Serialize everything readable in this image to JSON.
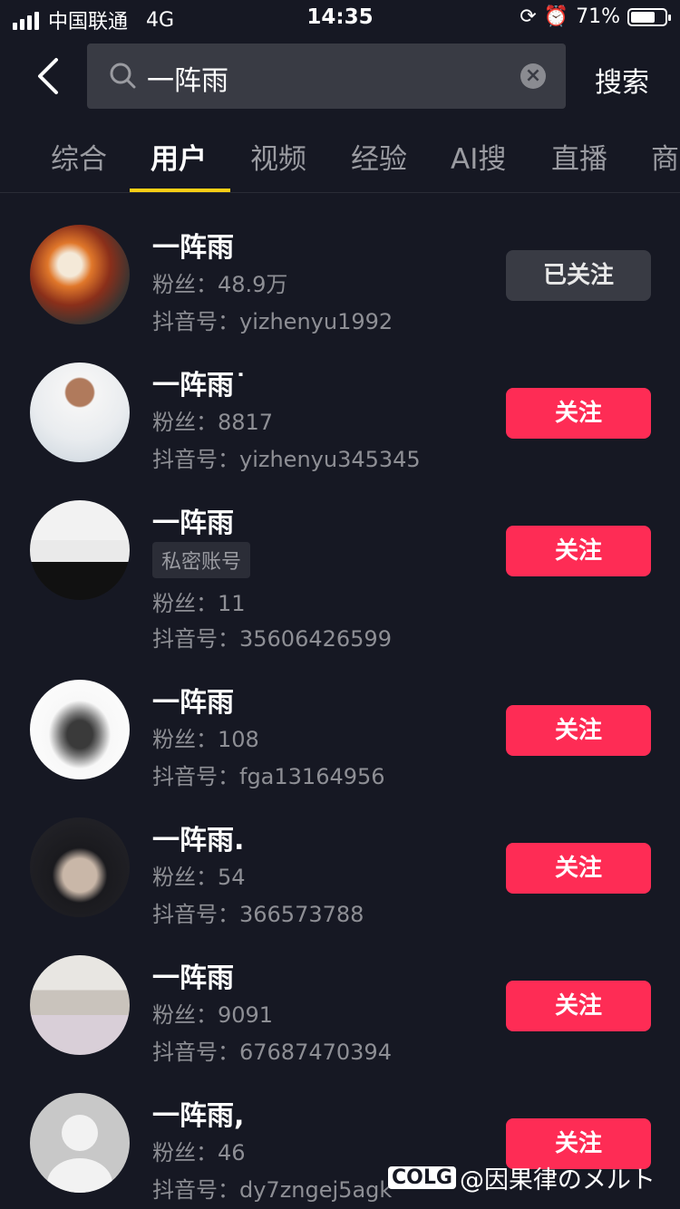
{
  "status_bar": {
    "carrier": "中国联通",
    "network": "4G",
    "time": "14:35",
    "battery": "71%",
    "battery_level": 0.71
  },
  "search": {
    "query": "一阵雨",
    "button_label": "搜索"
  },
  "tabs": [
    {
      "label": "综合",
      "active": false
    },
    {
      "label": "用户",
      "active": true
    },
    {
      "label": "视频",
      "active": false
    },
    {
      "label": "经验",
      "active": false
    },
    {
      "label": "AI搜",
      "active": false
    },
    {
      "label": "直播",
      "active": false
    },
    {
      "label": "商",
      "active": false
    }
  ],
  "users": [
    {
      "name": "一阵雨",
      "fans": "粉丝：48.9万",
      "id": "抖音号：yizhenyu1992",
      "button": "已关注",
      "followed": true,
      "avatar": "anime-fire-warrior"
    },
    {
      "name": "一阵雨˙",
      "fans": "粉丝：8817",
      "id": "抖音号：yizhenyu345345",
      "button": "关注",
      "followed": false,
      "avatar": "man-in-hoodie"
    },
    {
      "name": "一阵雨",
      "tag": "私密账号",
      "fans": "粉丝：11",
      "id": "抖音号：35606426599",
      "button": "关注",
      "followed": false,
      "avatar": "sketch-cap-boy"
    },
    {
      "name": "一阵雨",
      "fans": "粉丝：108",
      "id": "抖音号：fga13164956",
      "button": "关注",
      "followed": false,
      "avatar": "swordsman-hat"
    },
    {
      "name": "一阵雨.",
      "fans": "粉丝：54",
      "id": "抖音号：366573788",
      "button": "关注",
      "followed": false,
      "avatar": "anime-dark-hair"
    },
    {
      "name": "一阵雨",
      "fans": "粉丝：9091",
      "id": "抖音号：67687470394",
      "button": "关注",
      "followed": false,
      "avatar": "girl-in-studio"
    },
    {
      "name": "一阵雨,",
      "fans": "粉丝：46",
      "id": "抖音号：dy7zngej5agk",
      "button": "关注",
      "followed": false,
      "avatar": "default-avatar"
    }
  ],
  "watermark": {
    "logo": "COLG",
    "text": "@因果律のメルト"
  },
  "colors": {
    "background": "#161823",
    "accent": "#fe2c55",
    "tab_indicator": "#face15",
    "followed_button": "#393b44"
  }
}
